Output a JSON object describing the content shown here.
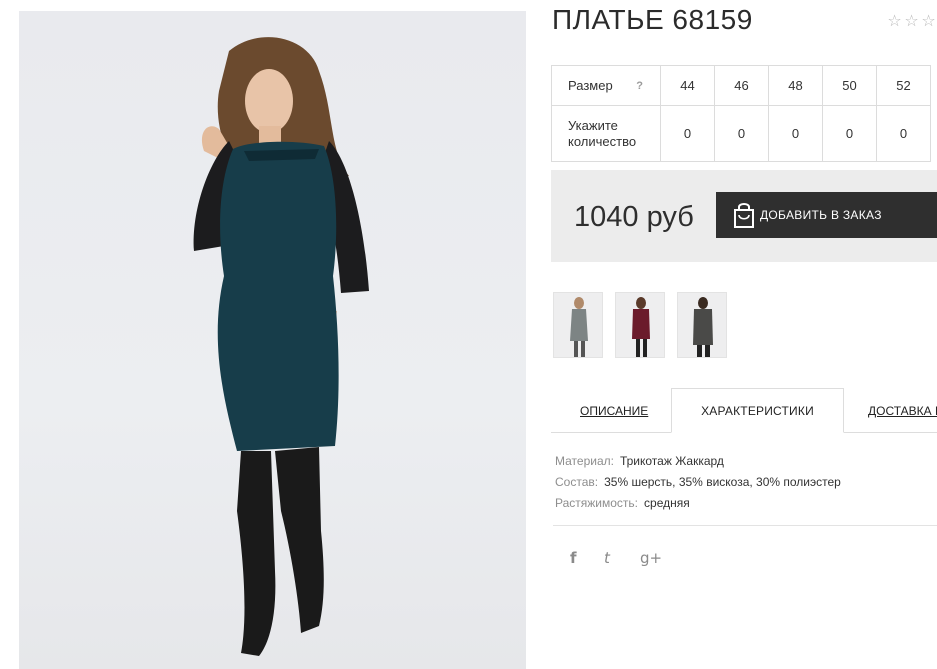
{
  "product": {
    "title": "ПЛАТЬЕ 68159",
    "rating_stars": [
      "☆",
      "☆",
      "☆"
    ]
  },
  "size_table": {
    "size_label": "Размер",
    "help_label": "?",
    "sizes": [
      "44",
      "46",
      "48",
      "50",
      "52"
    ],
    "quantity_label_line1": "Укажите",
    "quantity_label_line2": "количество",
    "quantities": [
      "0",
      "0",
      "0",
      "0",
      "0"
    ]
  },
  "purchase": {
    "price": "1040 руб",
    "order_button_label": "ДОБАВИТЬ В ЗАКАЗ"
  },
  "tabs": [
    {
      "label": "ОПИСАНИЕ",
      "active": false
    },
    {
      "label": "ХАРАКТЕРИСТИКИ",
      "active": true
    },
    {
      "label": "ДОСТАВКА И",
      "active": false
    }
  ],
  "specs": [
    {
      "key": "Материал:",
      "value": "Трикотаж Жаккард"
    },
    {
      "key": "Состав:",
      "value": "35% шерсть, 35% вискоза, 30% полиэстер"
    },
    {
      "key": "Растяжимость:",
      "value": "средняя"
    }
  ],
  "social": [
    "f",
    "t",
    "g+"
  ],
  "colors": {
    "dress_teal": "#173d4a",
    "thumb_grey": "#7d8484",
    "thumb_burgundy": "#6b1b2b",
    "thumb_dark_grey": "#4a4a48",
    "button_bg": "#2f2f2f",
    "price_bg": "#ececec"
  },
  "icons": {
    "order_button": "shopping-bag-icon",
    "help": "question-icon",
    "social": [
      "facebook-icon",
      "twitter-icon",
      "google-plus-icon"
    ]
  }
}
